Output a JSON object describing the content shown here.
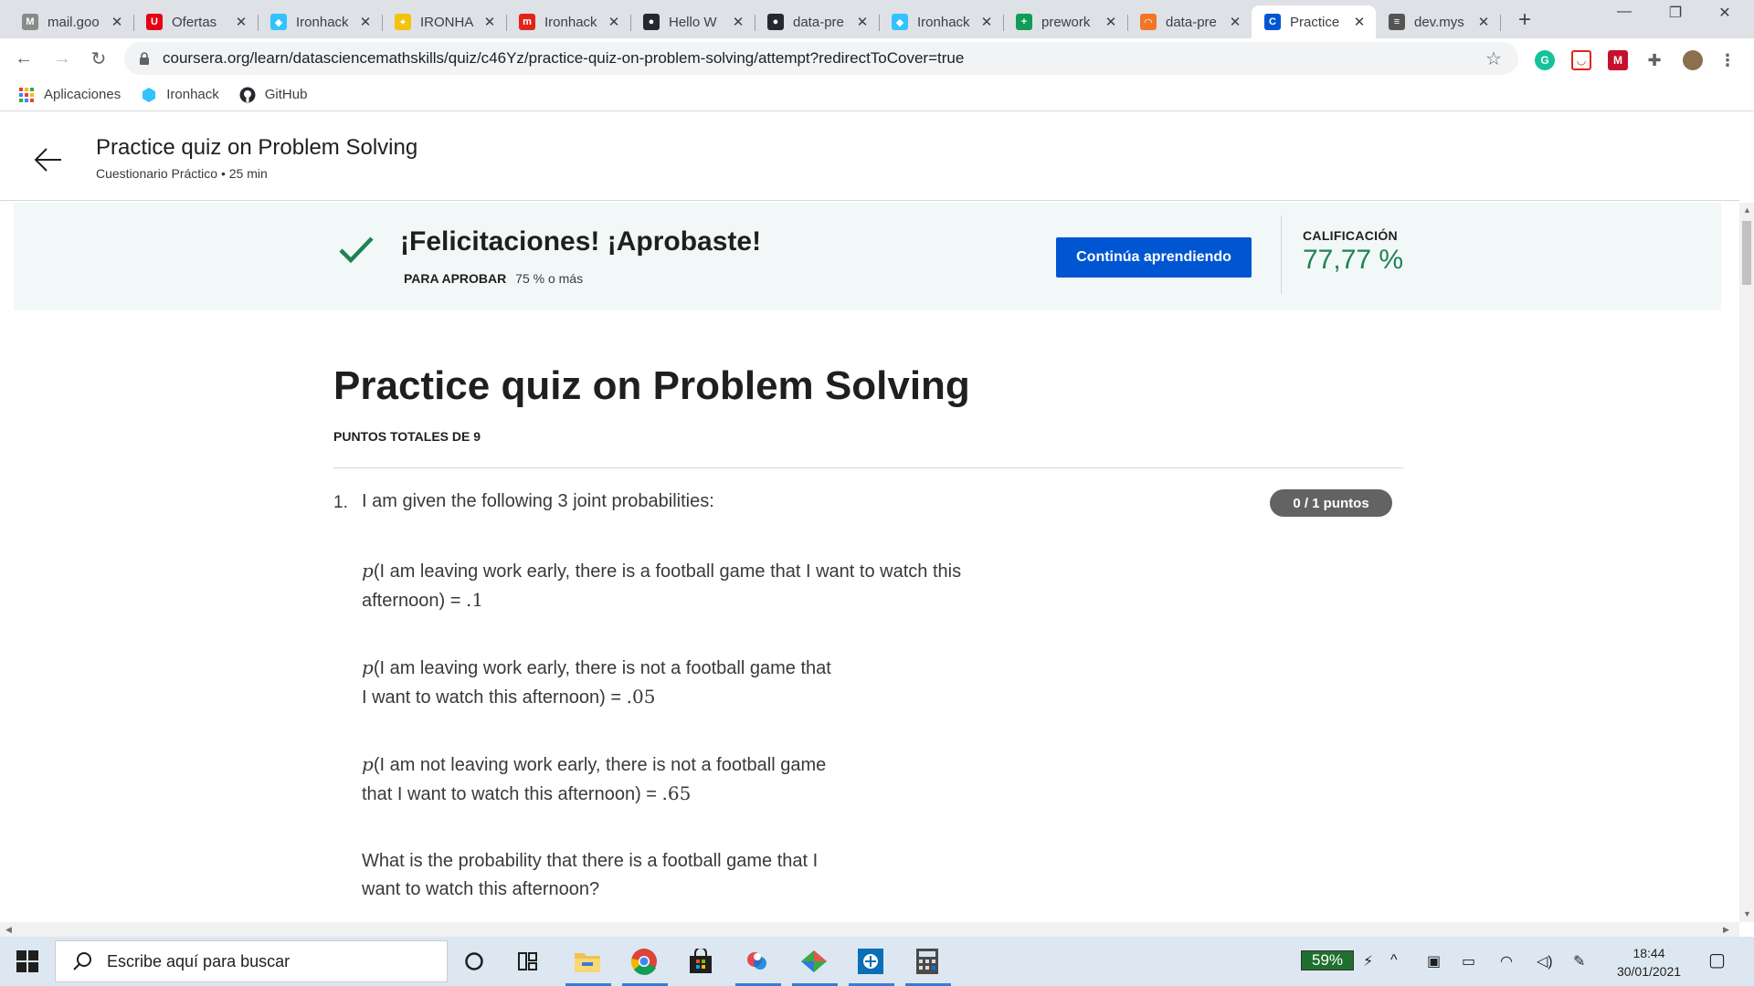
{
  "browser": {
    "tabs": [
      {
        "title": "mail.goo",
        "favicon": "gmail-icon",
        "color": "#8a8a8a",
        "glyph": "M"
      },
      {
        "title": "Ofertas",
        "favicon": "uniqlo-icon",
        "color": "#e60012",
        "glyph": "U"
      },
      {
        "title": "Ironhack",
        "favicon": "ironhack-icon",
        "color": "#32c3ff",
        "glyph": "◆"
      },
      {
        "title": "IRONHA",
        "favicon": "handshake-icon",
        "color": "#f4c20d",
        "glyph": "✦"
      },
      {
        "title": "Ironhack",
        "favicon": "ironhack-m-icon",
        "color": "#e2231a",
        "glyph": "m"
      },
      {
        "title": "Hello W",
        "favicon": "github-icon",
        "color": "#24292e",
        "glyph": "●"
      },
      {
        "title": "data-pre",
        "favicon": "github-icon",
        "color": "#24292e",
        "glyph": "●"
      },
      {
        "title": "Ironhack",
        "favicon": "ironhack-icon",
        "color": "#32c3ff",
        "glyph": "◆"
      },
      {
        "title": "prework",
        "favicon": "sheets-icon",
        "color": "#0f9d58",
        "glyph": "+"
      },
      {
        "title": "data-pre",
        "favicon": "jupyter-icon",
        "color": "#f37626",
        "glyph": "◠"
      },
      {
        "title": "Practice",
        "favicon": "coursera-icon",
        "color": "#0056d2",
        "glyph": "C",
        "active": true
      },
      {
        "title": "dev.mys",
        "favicon": "mysql-icon",
        "color": "#555555",
        "glyph": "≡"
      }
    ],
    "url": "coursera.org/learn/datasciencemathskills/quiz/c46Yz/practice-quiz-on-problem-solving/attempt?redirectToCover=true",
    "bookmarks": [
      {
        "label": "Aplicaciones",
        "icon": "apps-grid-icon"
      },
      {
        "label": "Ironhack",
        "icon": "ironhack-icon"
      },
      {
        "label": "GitHub",
        "icon": "github-icon"
      }
    ]
  },
  "header": {
    "title": "Practice quiz on Problem Solving",
    "subtitle": "Cuestionario Práctico • 25 min"
  },
  "result": {
    "message": "¡Felicitaciones! ¡Aprobaste!",
    "pass_label": "PARA APROBAR",
    "pass_value": "75 % o más",
    "button": "Continúa aprendiendo",
    "grade_label": "CALIFICACIÓN",
    "grade_value": "77,77 %"
  },
  "quiz": {
    "title": "Practice quiz on Problem Solving",
    "total_points": "PUNTOS TOTALES DE 9",
    "question": {
      "number": "1.",
      "text": "I am given the following 3 joint probabilities:",
      "score": "0 / 1 puntos",
      "p_symbol": "p",
      "items": [
        {
          "line1": "(I am leaving work early, there is a football game that I want to watch this",
          "line2": "afternoon) = ",
          "value": ".1"
        },
        {
          "line1": "(I am leaving work early, there is not a football game that",
          "line2": "I want to watch this afternoon) = ",
          "value": ".05"
        },
        {
          "line1": "(I am not leaving work early, there is not a football game",
          "line2": "that I want to watch this afternoon) = ",
          "value": ".65"
        }
      ],
      "prompt_line1": "What is the probability that there is a football game that I",
      "prompt_line2": "want to watch this afternoon?"
    }
  },
  "taskbar": {
    "search_placeholder": "Escribe aquí para buscar",
    "battery": "59%",
    "time": "18:44",
    "date": "30/01/2021"
  }
}
